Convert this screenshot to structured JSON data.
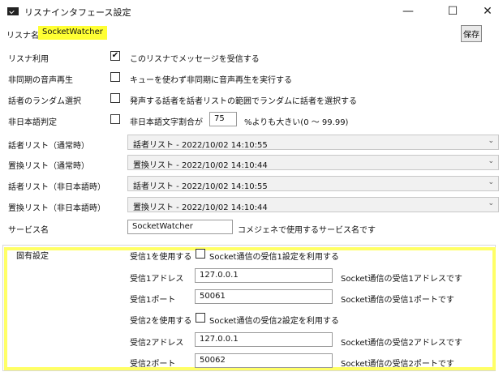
{
  "window": {
    "title": "リスナインタフェース設定"
  },
  "header": {
    "listener_label": "リスナ名",
    "listener_name": "SocketWatcher",
    "save_label": "保存"
  },
  "options": {
    "use_listener": {
      "label": "リスナ利用",
      "desc": "このリスナでメッセージを受信する",
      "checked": "✔"
    },
    "async_voice": {
      "label": "非同期の音声再生",
      "desc": "キューを使わず非同期に音声再生を実行する"
    },
    "random_speaker": {
      "label": "話者のランダム選択",
      "desc": "発声する話者を話者リストの範囲でランダムに話者を選択する"
    },
    "non_japanese": {
      "label": "非日本語判定",
      "desc_prefix": "非日本語文字割合が",
      "value": "75",
      "desc_suffix": "%よりも大きい(0 ～ 99.99)"
    }
  },
  "lists": [
    {
      "label": "話者リスト（通常時）",
      "value": "話者リスト - 2022/10/02 14:10:55"
    },
    {
      "label": "置換リスト（通常時）",
      "value": "置換リスト - 2022/10/02 14:10:44"
    },
    {
      "label": "話者リスト（非日本語時）",
      "value": "話者リスト - 2022/10/02 14:10:55"
    },
    {
      "label": "置換リスト（非日本語時）",
      "value": "置換リスト - 2022/10/02 14:10:44"
    }
  ],
  "service": {
    "label": "サービス名",
    "value": "SocketWatcher",
    "desc": "コメジェネで使用するサービス名です"
  },
  "specific": {
    "title": "固有設定",
    "recv1_use": {
      "label": "受信1を使用する",
      "desc": "Socket通信の受信1設定を利用する"
    },
    "recv1_addr": {
      "label": "受信1アドレス",
      "value": "127.0.0.1",
      "desc": "Socket通信の受信1アドレスです"
    },
    "recv1_port": {
      "label": "受信1ポート",
      "value": "50061",
      "desc": "Socket通信の受信1ポートです"
    },
    "recv2_use": {
      "label": "受信2を使用する",
      "desc": "Socket通信の受信2設定を利用する"
    },
    "recv2_addr": {
      "label": "受信2アドレス",
      "value": "127.0.0.1",
      "desc": "Socket通信の受信2アドレスです"
    },
    "recv2_port": {
      "label": "受信2ポート",
      "value": "50062",
      "desc": "Socket通信の受信2ポートです"
    }
  },
  "icons": {
    "minimize": "—",
    "maximize": "☐",
    "close": "✕",
    "chevron": "⌄"
  }
}
